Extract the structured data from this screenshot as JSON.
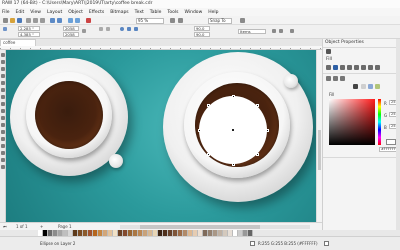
{
  "window": {
    "title": "RAW 17 (64-Bit) - C:\\Users\\Mary\\ART\\|2019\\IT\\arty\\coffee break.cdr"
  },
  "menu": [
    "File",
    "Edit",
    "View",
    "Layout",
    "Object",
    "Effects",
    "Bitmaps",
    "Text",
    "Table",
    "Tools",
    "Window",
    "Help"
  ],
  "toolbar": {
    "zoom": "95 %",
    "snap_to": "Snap To",
    "unit": "Items"
  },
  "propbar": {
    "x": "2.285 \"",
    "y": "4.385 \"",
    "w": "2058",
    "h": "2058",
    "angle_start": "90.0",
    "angle_end": "90.0",
    "outline": "Items"
  },
  "document": {
    "tab": "coffee break.cdr"
  },
  "pagebar": {
    "counter": "1 of 1",
    "page": "Page 1"
  },
  "statusbar": {
    "text": "Ellipse on Layer 2",
    "fill_text": "R:255 G:255 B:255 (#FFFFFF)"
  },
  "docker": {
    "title": "Object Properties",
    "fill_label": "Fill",
    "section_label": "Fill",
    "r_value": "255",
    "g_value": "255",
    "b_value": "255",
    "hex_value": "#FFFFFF"
  },
  "colors": {
    "canvas": "#2b9a9c",
    "coffee": "#4a230f",
    "selected_fill": "#ffffff"
  },
  "palette": [
    "#ffffff",
    "#000000",
    "#6c6c6c",
    "#8c8c8c",
    "#a6a6a6",
    "#bfbfbf",
    "#d8d8d8",
    "#5d3a1a",
    "#7a4b22",
    "#8b5a2b",
    "#a0522d",
    "#b5651d",
    "#c68642",
    "#d2a679",
    "#e3c39d",
    "#f1e1c6",
    "#6b4226",
    "#834a2e",
    "#996633",
    "#aa7744",
    "#bb8855",
    "#c8a27a",
    "#d6b894",
    "#e8d5b5",
    "#3b2314",
    "#4f2f1b",
    "#66412a",
    "#7f5539",
    "#9c6b47",
    "#b08968",
    "#ddb892",
    "#e6ccb2",
    "#ede0d4",
    "#7f6a5a",
    "#948170",
    "#a99786",
    "#c0b2a4",
    "#d4c9bd",
    "#e7dfd7",
    "#ffffff",
    "#cccccc",
    "#999999",
    "#666666"
  ]
}
